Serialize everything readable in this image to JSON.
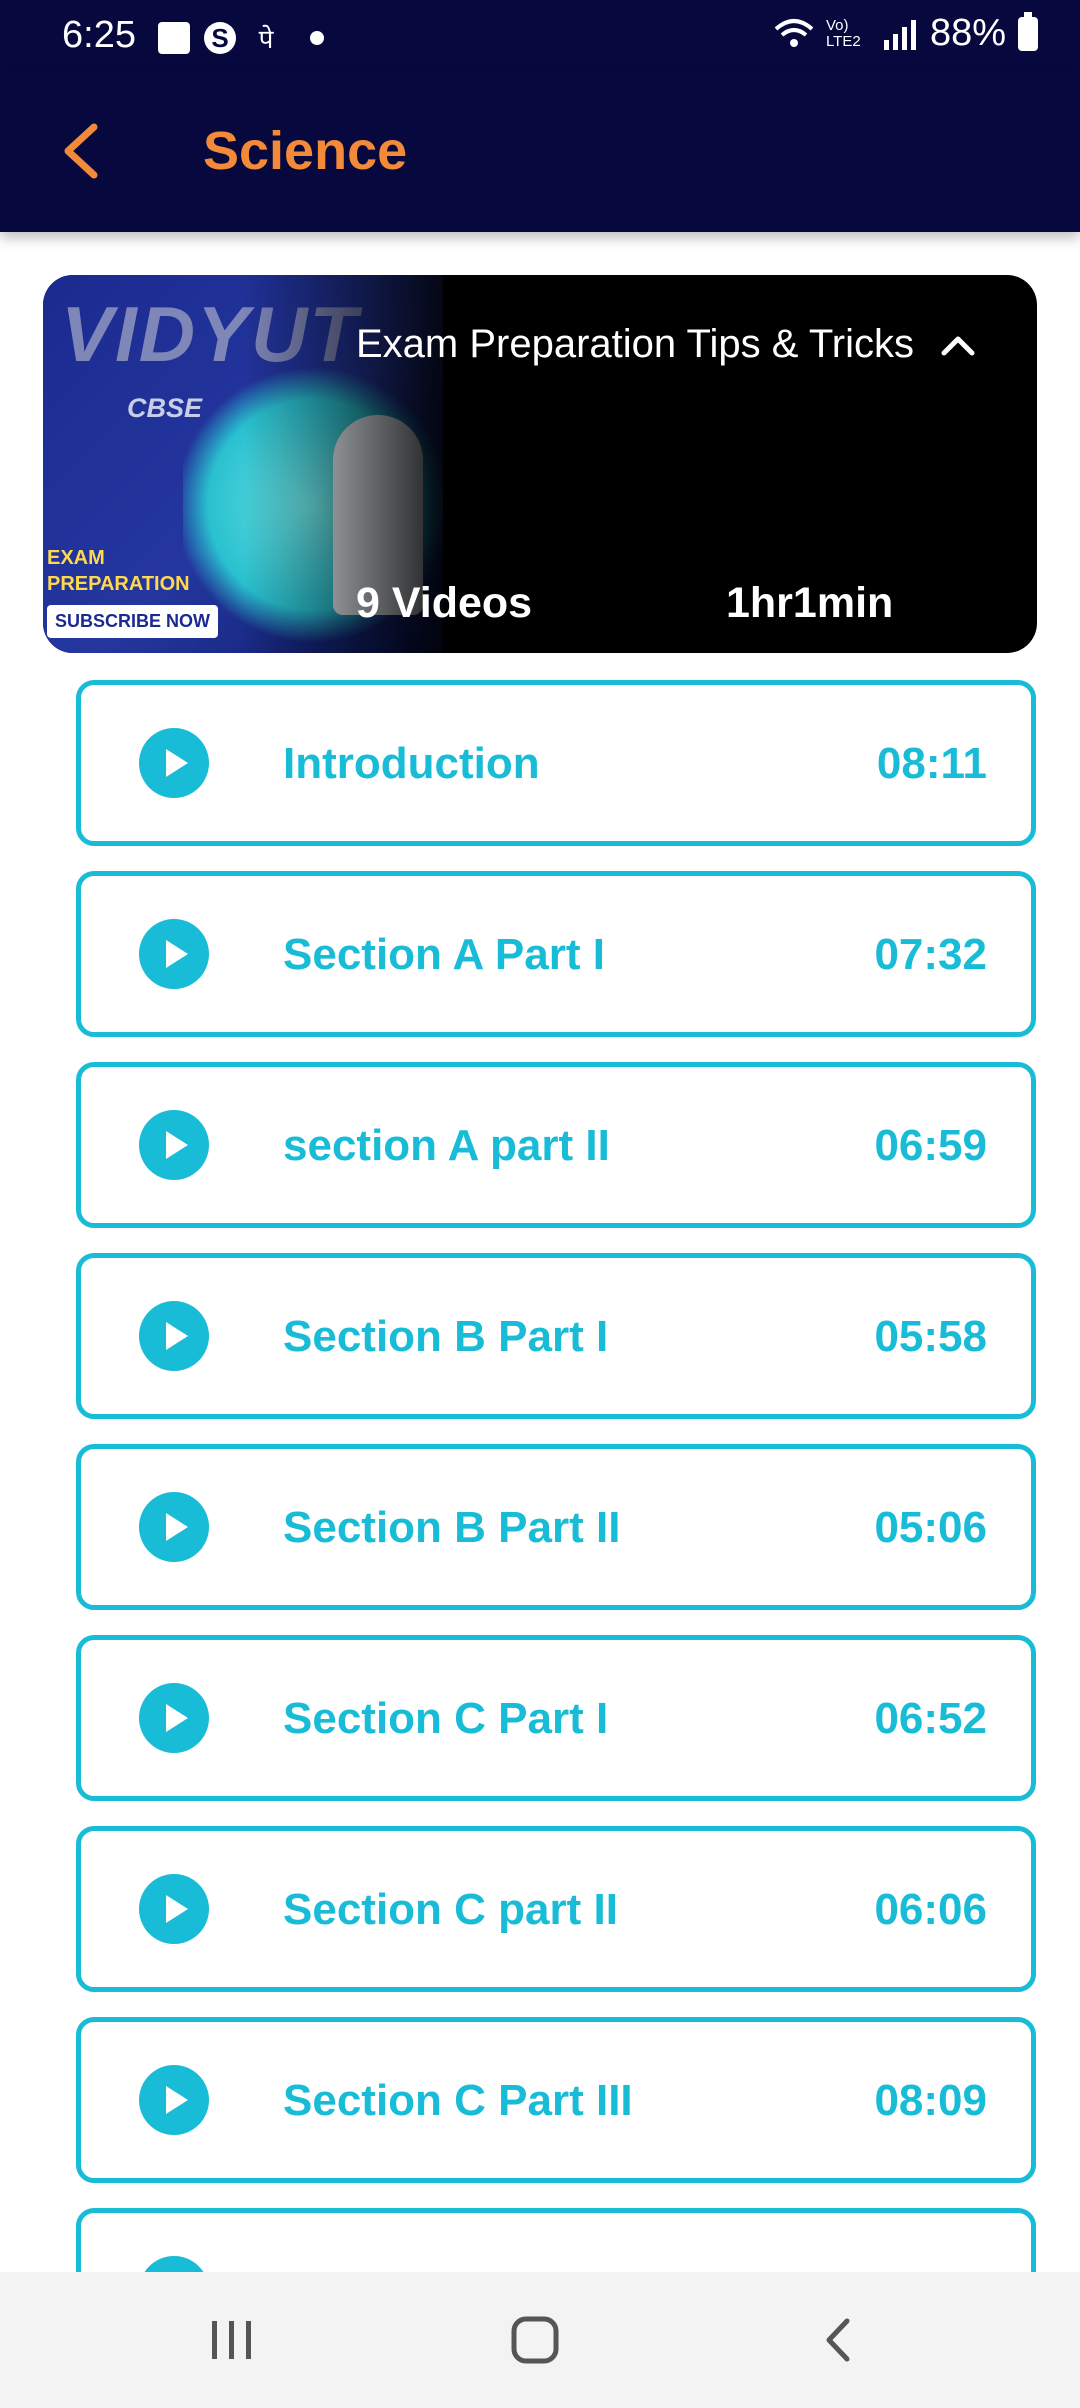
{
  "status_bar": {
    "time": "6:25",
    "devanagari_glyph": "पे",
    "network_label": "Vo) LTE2",
    "battery": "88%"
  },
  "app_bar": {
    "title": "Science",
    "accent_color": "#f38a3a",
    "background_color": "#07083d"
  },
  "course": {
    "thumbnail": {
      "logo_text": "VIDYUT",
      "board": "CBSE",
      "tag": "EXAM PREPARATION",
      "cta": "SUBSCRIBE NOW"
    },
    "title": "Exam Preparation Tips & Tricks",
    "video_count": "9 Videos",
    "duration": "1hr1min",
    "expanded": true
  },
  "videos": [
    {
      "title": "Introduction",
      "duration": "08:11"
    },
    {
      "title": "Section A Part I",
      "duration": "07:32"
    },
    {
      "title": "section A part II",
      "duration": "06:59"
    },
    {
      "title": "Section B Part I",
      "duration": "05:58"
    },
    {
      "title": "Section B Part II",
      "duration": "05:06"
    },
    {
      "title": "Section C Part I",
      "duration": "06:52"
    },
    {
      "title": "Section C part II",
      "duration": "06:06"
    },
    {
      "title": "Section C Part III",
      "duration": "08:09"
    },
    {
      "title": "",
      "duration": ""
    }
  ],
  "theme": {
    "list_accent": "#19bcd6"
  },
  "nav_bar": {
    "recents_icon": "recents-icon",
    "home_icon": "home-icon",
    "back_icon": "back-icon"
  }
}
